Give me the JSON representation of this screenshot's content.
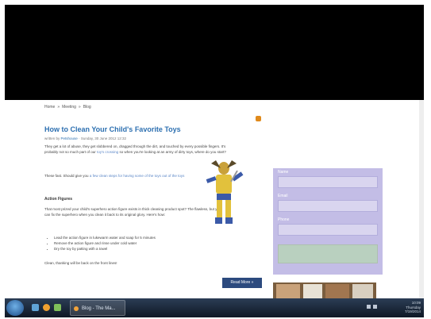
{
  "breadcrumb": [
    "Home",
    "»",
    "Meeting",
    "»",
    "Blog"
  ],
  "post": {
    "title": "How to Clean Your Child's Favorite Toys",
    "meta_prefix": "written by",
    "meta_author": "Petshouse",
    "meta_date": "Sunday, 30 June 2012 12:32",
    "para1_text": "They get a lot of abuse, they get slobbered on, dragged through the dirt, and touched by every possible fingers. It's probably not so much part of our",
    "para1_link": "toy's crossing",
    "para1_tail": "so when you're looking at an army of dirty toys, where do you start?",
    "para2_text": "These fast. Should give you",
    "para2_link": "a few clean steps for having some of the toys out of the toys",
    "section_heading": "Action Figures",
    "para3": "That most prized your child's superhero action figure exists in thick cleaning product spot? The flawless, but you can fix the superhero when you clean it back to its original glory. Here's how:",
    "bullets": [
      "Lead the action figure in lukewarm water and soap for 5 minutes",
      "Remove the action figure and rinse under cold water",
      "Dry the toy by patting with a towel"
    ],
    "para4": "Clean, thanking will be back on the front lines!",
    "read_more": "Read More »"
  },
  "form": {
    "name_label": "Name",
    "email_label": "Email",
    "phone_label": "Phone"
  },
  "taskbar": {
    "window_label": "Blog - The Ma...",
    "clock_time": "10:09",
    "clock_day": "Thursday",
    "clock_date": "7/19/2014"
  },
  "colors": {
    "title": "#2c6fb0",
    "form_bg": "#c3bde6",
    "read_more_bg": "#2c4a7e",
    "taskbar_bg": "#1a2638"
  }
}
